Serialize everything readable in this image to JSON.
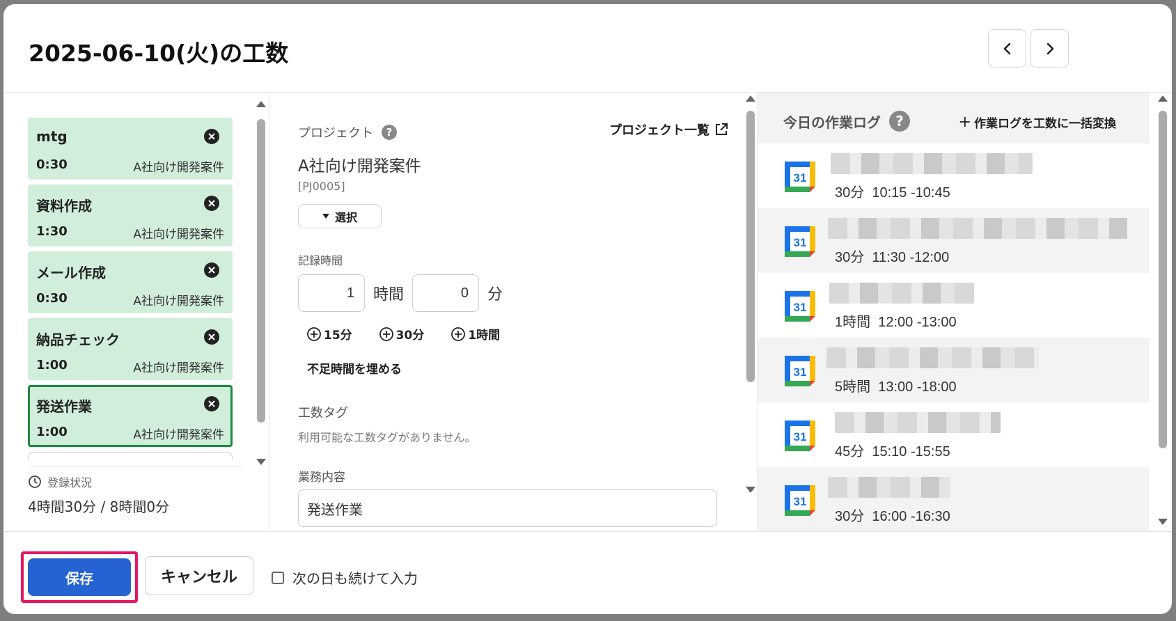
{
  "dialog": {
    "title": "2025-06-10(火)の工数",
    "prev_icon": "chevron-left-icon",
    "next_icon": "chevron-right-icon"
  },
  "entries": [
    {
      "name": "mtg",
      "time": "0:30",
      "project": "A社向け開発案件",
      "selected": false
    },
    {
      "name": "資料作成",
      "time": "1:30",
      "project": "A社向け開発案件",
      "selected": false
    },
    {
      "name": "メール作成",
      "time": "0:30",
      "project": "A社向け開発案件",
      "selected": false
    },
    {
      "name": "納品チェック",
      "time": "1:00",
      "project": "A社向け開発案件",
      "selected": false
    },
    {
      "name": "発送作業",
      "time": "1:00",
      "project": "A社向け開発案件",
      "selected": true
    }
  ],
  "status": {
    "label": "登録状況",
    "value": "4時間30分 / 8時間0分"
  },
  "form": {
    "project_label": "プロジェクト",
    "project_list_link": "プロジェクト一覧",
    "project_name": "A社向け開発案件",
    "project_code": "[PJ0005]",
    "select_label": "選択",
    "record_time_label": "記録時間",
    "hours_value": "1",
    "hours_unit": "時間",
    "minutes_value": "0",
    "minutes_unit": "分",
    "quick_add": [
      "15分",
      "30分",
      "1時間"
    ],
    "fill_shortage": "不足時間を埋める",
    "tag_label": "工数タグ",
    "tag_empty": "利用可能な工数タグがありません。",
    "task_label": "業務内容",
    "task_value": "発送作業"
  },
  "work_log": {
    "title": "今日の作業ログ",
    "bulk_convert": "作業ログを工数に一括変換",
    "items": [
      {
        "duration": "30分",
        "range": "10:15 -10:45"
      },
      {
        "duration": "30分",
        "range": "11:30 -12:00"
      },
      {
        "duration": "1時間",
        "range": "12:00 -13:00"
      },
      {
        "duration": "5時間",
        "range": "13:00 -18:00"
      },
      {
        "duration": "45分",
        "range": "15:10 -15:55"
      },
      {
        "duration": "30分",
        "range": "16:00 -16:30"
      }
    ]
  },
  "footer": {
    "save": "保存",
    "cancel": "キャンセル",
    "continue_label": "次の日も続けて入力"
  },
  "colors": {
    "entry_bg": "#d1eedb",
    "selected_border": "#1e8a3c",
    "primary": "#2563d2",
    "highlight": "#e81566"
  }
}
